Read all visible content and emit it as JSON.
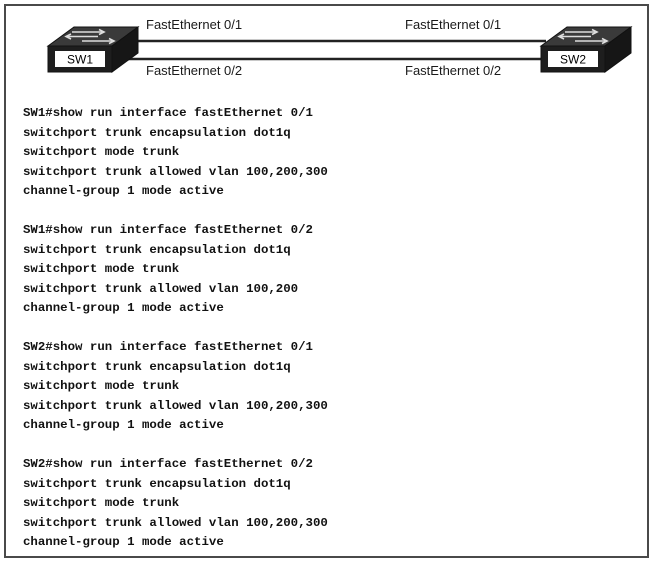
{
  "switches": {
    "sw1": {
      "label": "SW1"
    },
    "sw2": {
      "label": "SW2"
    }
  },
  "links": {
    "top": {
      "left_port": "FastEthernet 0/1",
      "right_port": "FastEthernet 0/1"
    },
    "bottom": {
      "left_port": "FastEthernet 0/2",
      "right_port": "FastEthernet 0/2"
    }
  },
  "colors": {
    "switch_body": "#1e1e1e",
    "switch_top": "#3a3a3a",
    "switch_label_bg": "#ffffff",
    "link_line": "#222222"
  },
  "config_blocks": [
    {
      "command": "SW1#show run interface fastEthernet 0/1",
      "lines": [
        "switchport trunk encapsulation dot1q",
        "switchport mode trunk",
        "switchport trunk allowed vlan 100,200,300",
        "channel-group 1 mode active"
      ]
    },
    {
      "command": "SW1#show run interface fastEthernet 0/2",
      "lines": [
        "switchport trunk encapsulation dot1q",
        "switchport mode trunk",
        "switchport trunk allowed vlan 100,200",
        "channel-group 1 mode active"
      ]
    },
    {
      "command": "SW2#show run interface fastEthernet 0/1",
      "lines": [
        "switchport trunk encapsulation dot1q",
        "switchport mode trunk",
        "switchport trunk allowed vlan 100,200,300",
        "channel-group 1 mode active"
      ]
    },
    {
      "command": "SW2#show run interface fastEthernet 0/2",
      "lines": [
        "switchport trunk encapsulation dot1q",
        "switchport mode trunk",
        "switchport trunk allowed vlan 100,200,300",
        "channel-group 1 mode active"
      ]
    }
  ]
}
